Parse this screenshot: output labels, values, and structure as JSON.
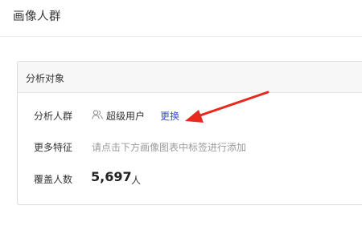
{
  "page": {
    "title": "画像人群"
  },
  "panel": {
    "title": "分析对象",
    "segment": {
      "label": "分析人群",
      "icon": "users-icon",
      "name": "超级用户",
      "change_link": "更换"
    },
    "features": {
      "label": "更多特征",
      "hint": "请点击下方画像图表中标签进行添加"
    },
    "coverage": {
      "label": "覆盖人数",
      "value": "5,697",
      "unit": "人"
    }
  },
  "annotation": {
    "icon": "red-arrow-icon",
    "color": "#e8281d"
  },
  "colors": {
    "link": "#3d4fcf",
    "hint": "#9a9a9a",
    "border": "#dcdcdc",
    "header_bg": "#f7f7f7"
  }
}
